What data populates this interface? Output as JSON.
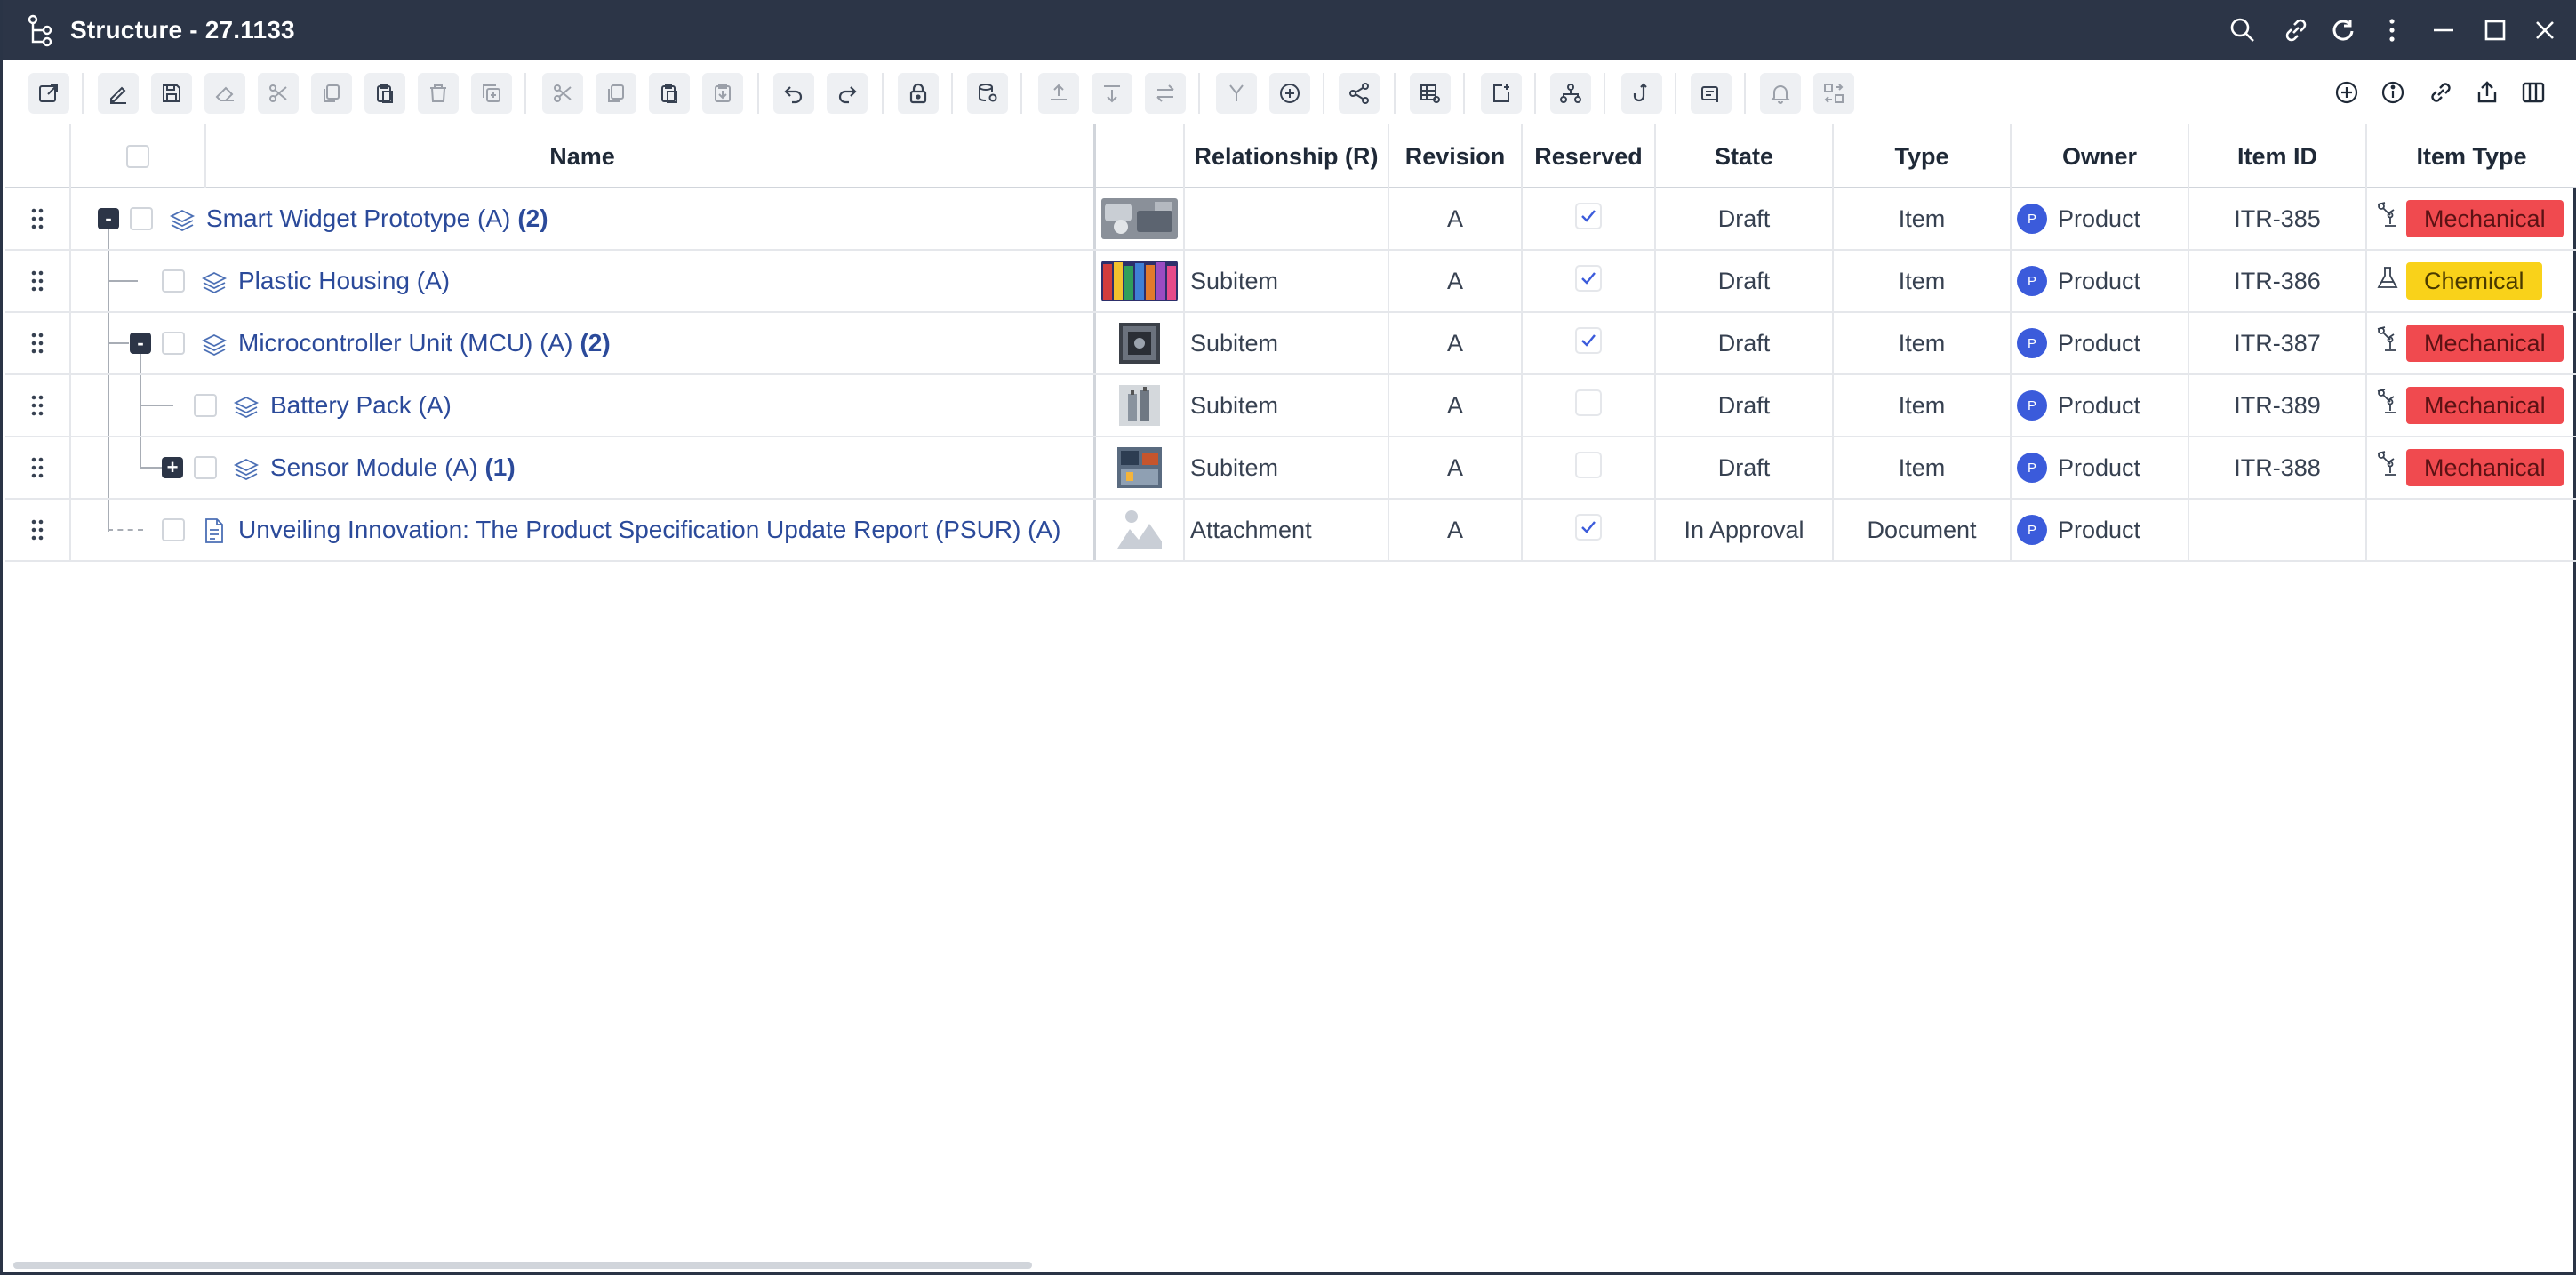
{
  "window": {
    "title": "Structure - 27.1133"
  },
  "columns": {
    "name": "Name",
    "relationship": "Relationship (R)",
    "revision": "Revision",
    "reserved": "Reserved",
    "state": "State",
    "type": "Type",
    "owner": "Owner",
    "item_id": "Item ID",
    "item_type": "Item Type"
  },
  "rows": [
    {
      "name": "Smart Widget Prototype (A)",
      "count": "(2)",
      "relationship": "",
      "revision": "A",
      "reserved": true,
      "state": "Draft",
      "type": "Item",
      "owner_initial": "P",
      "owner": "Product",
      "item_id": "ITR-385",
      "item_type": "Mechanical",
      "item_type_icon": "robot-arm-icon",
      "toggle": "-"
    },
    {
      "name": "Plastic Housing (A)",
      "count": "",
      "relationship": "Subitem",
      "revision": "A",
      "reserved": true,
      "state": "Draft",
      "type": "Item",
      "owner_initial": "P",
      "owner": "Product",
      "item_id": "ITR-386",
      "item_type": "Chemical",
      "item_type_icon": "flask-icon",
      "toggle": ""
    },
    {
      "name": "Microcontroller Unit (MCU) (A)",
      "count": "(2)",
      "relationship": "Subitem",
      "revision": "A",
      "reserved": true,
      "state": "Draft",
      "type": "Item",
      "owner_initial": "P",
      "owner": "Product",
      "item_id": "ITR-387",
      "item_type": "Mechanical",
      "item_type_icon": "robot-arm-icon",
      "toggle": "-"
    },
    {
      "name": "Battery Pack (A)",
      "count": "",
      "relationship": "Subitem",
      "revision": "A",
      "reserved": false,
      "state": "Draft",
      "type": "Item",
      "owner_initial": "P",
      "owner": "Product",
      "item_id": "ITR-389",
      "item_type": "Mechanical",
      "item_type_icon": "robot-arm-icon",
      "toggle": ""
    },
    {
      "name": "Sensor Module (A)",
      "count": "(1)",
      "relationship": "Subitem",
      "revision": "A",
      "reserved": false,
      "state": "Draft",
      "type": "Item",
      "owner_initial": "P",
      "owner": "Product",
      "item_id": "ITR-388",
      "item_type": "Mechanical",
      "item_type_icon": "robot-arm-icon",
      "toggle": "+"
    },
    {
      "name": "Unveiling Innovation: The Product Specification Update Report (PSUR) (A)",
      "count": "",
      "relationship": "Attachment",
      "revision": "A",
      "reserved": true,
      "state": "In Approval",
      "type": "Document",
      "owner_initial": "P",
      "owner": "Product",
      "item_id": "",
      "item_type": "",
      "item_type_icon": "",
      "toggle": ""
    }
  ],
  "colors": {
    "titlebar": "#2c3547",
    "link": "#2b4a9a",
    "mechanical": "#f04a4f",
    "chemical": "#f9d21a",
    "avatar": "#3b5bdb"
  }
}
